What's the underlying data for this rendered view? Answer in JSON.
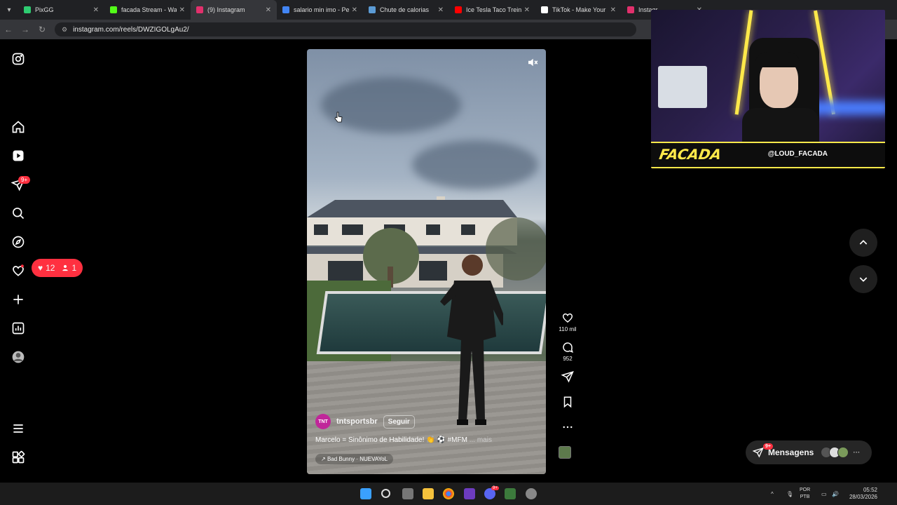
{
  "browser": {
    "tabs": [
      {
        "label": "PixGG",
        "color": "#2ecc71",
        "active": false
      },
      {
        "label": "facada Stream - Wate",
        "color": "#53fc18",
        "active": false
      },
      {
        "label": "(9) Instagram",
        "color": "#e1306c",
        "active": true
      },
      {
        "label": "salario min imo - Pes",
        "color": "#4285f4",
        "active": false
      },
      {
        "label": "Chute de calorias",
        "color": "#5b9bd5",
        "active": false
      },
      {
        "label": "Ice Tesla Taco Treino I",
        "color": "#ff0000",
        "active": false
      },
      {
        "label": "TikTok - Make Your D",
        "color": "#ffffff",
        "active": false
      },
      {
        "label": "Instagr",
        "color": "#e1306c",
        "active": false
      }
    ],
    "url": "instagram.com/reels/DWZIGOLgAu2/"
  },
  "sidebar": {
    "badge_messages": "9+",
    "notifications": {
      "likes": "12",
      "follows": "1"
    }
  },
  "reel": {
    "author": "tntsportsbr",
    "author_avatar_text": "TNT",
    "follow_label": "Seguir",
    "caption": "Marcelo = Sinônimo de Habilidade! 👏 ⚽ #MFM",
    "more_label": "... mais",
    "audio": "Bad Bunny · NUEVAYoL",
    "likes": "110 mil",
    "comments": "952"
  },
  "messages": {
    "label": "Mensagens",
    "badge": "9+"
  },
  "webcam": {
    "brand": "FACADA",
    "handle": "@LOUD_FACADA"
  },
  "taskbar": {
    "lang_top": "POR",
    "lang_bottom": "PTB",
    "time": "05:52",
    "date": "28/03/2026",
    "discord_badge": "9+"
  },
  "colors": {
    "accent_red": "#ff3040",
    "background": "#000000",
    "stream_yellow": "#ffe94a"
  }
}
